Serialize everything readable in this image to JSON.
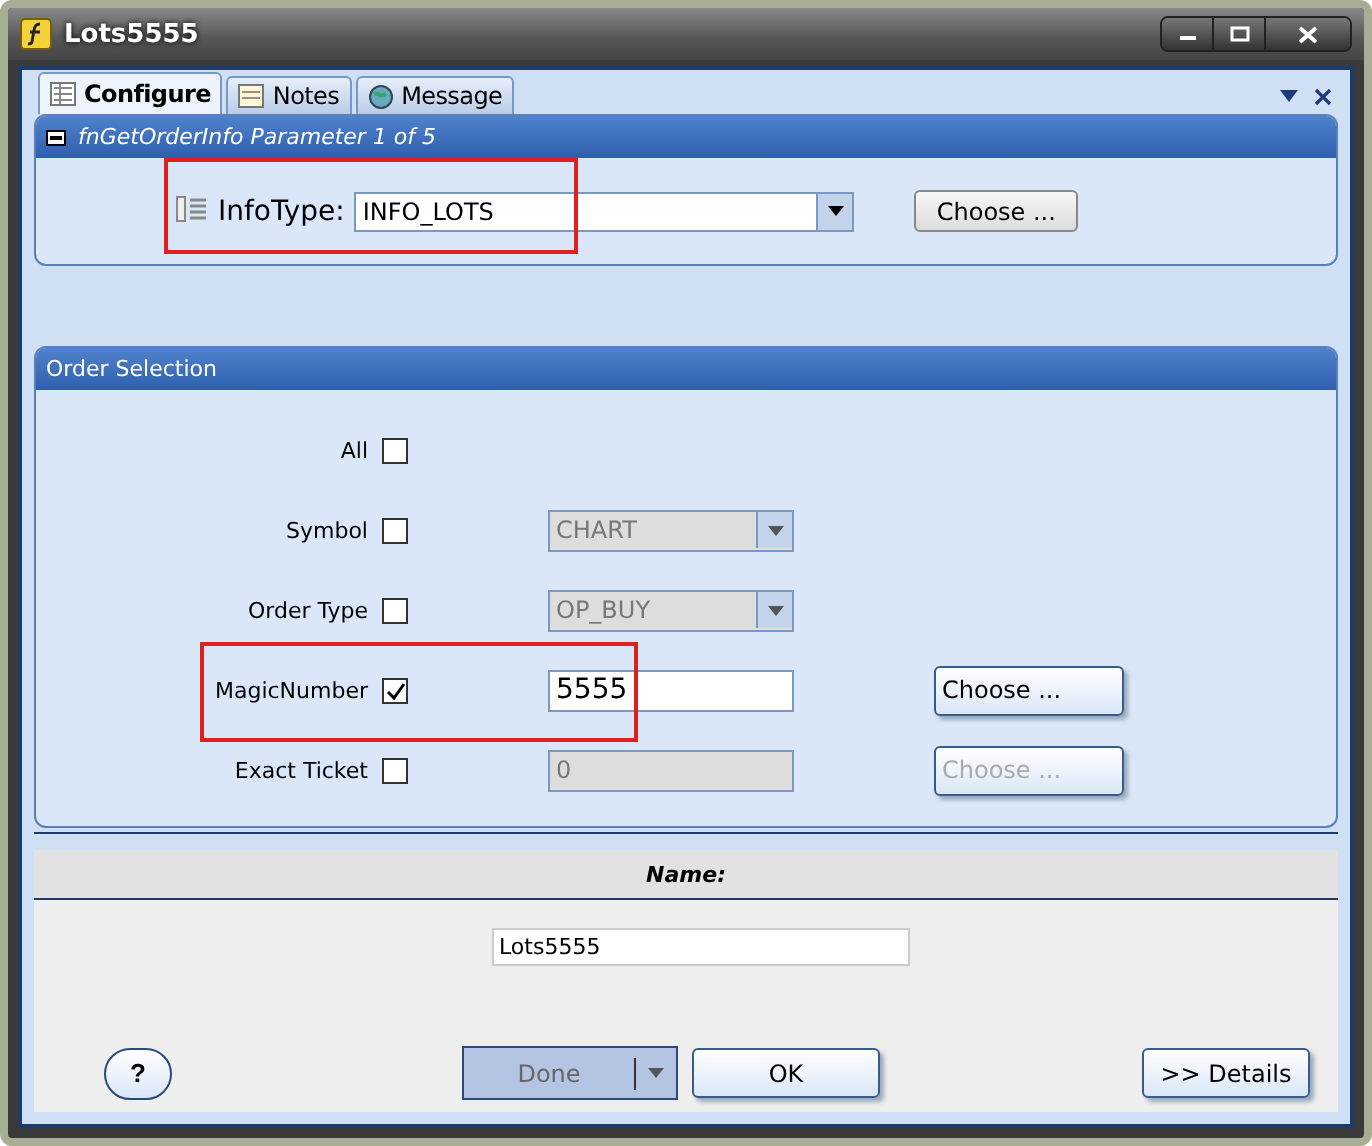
{
  "window": {
    "title": "Lots5555"
  },
  "tabs": [
    {
      "label": "Configure",
      "selected": true
    },
    {
      "label": "Notes",
      "selected": false
    },
    {
      "label": "Message",
      "selected": false
    }
  ],
  "parameter_panel": {
    "title": "fnGetOrderInfo  Parameter 1 of 5",
    "label": "InfoType:",
    "value": "INFO_LOTS",
    "highlighted": true,
    "choose_button": "Choose ..."
  },
  "order_selection": {
    "title": "Order Selection",
    "rows": [
      {
        "label": "All",
        "checked": false,
        "kind": "checkbox",
        "highlighted": false
      },
      {
        "label": "Symbol",
        "checked": false,
        "kind": "dropdown",
        "value": "CHART",
        "disabled": true,
        "highlighted": false
      },
      {
        "label": "Order Type",
        "checked": false,
        "kind": "dropdown",
        "value": "OP_BUY",
        "disabled": true,
        "highlighted": false
      },
      {
        "label": "MagicNumber",
        "checked": true,
        "kind": "text",
        "value": "5555",
        "disabled": false,
        "highlighted": true,
        "choose_button": "Choose ...",
        "choose_disabled": false
      },
      {
        "label": "Exact Ticket",
        "checked": false,
        "kind": "text",
        "value": "0",
        "disabled": true,
        "highlighted": false,
        "choose_button": "Choose ...",
        "choose_disabled": true
      }
    ]
  },
  "name_section": {
    "heading": "Name:",
    "value": "Lots5555"
  },
  "buttons": {
    "help": "?",
    "done": "Done",
    "done_disabled": true,
    "ok": "OK",
    "details": ">> Details"
  }
}
